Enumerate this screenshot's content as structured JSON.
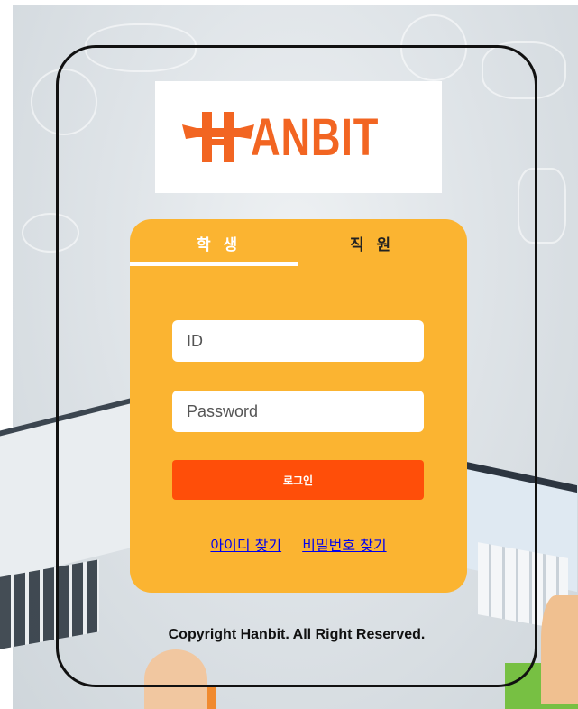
{
  "logo": {
    "text": "ANBIT",
    "alt": "HANBIT"
  },
  "tabs": [
    {
      "label": "학 생",
      "active": true
    },
    {
      "label": "직 원",
      "active": false
    }
  ],
  "form": {
    "id_placeholder": "ID",
    "id_value": "",
    "password_placeholder": "Password",
    "password_value": "",
    "login_label": "로그인"
  },
  "links": {
    "find_id": "아이디 찾기",
    "find_password": "비밀번호 찾기"
  },
  "footer": {
    "copyright": "Copyright Hanbit. All Right Reserved."
  },
  "colors": {
    "panel": "#fbb431",
    "login_button": "#ff4e09",
    "logo": "#f26522"
  }
}
